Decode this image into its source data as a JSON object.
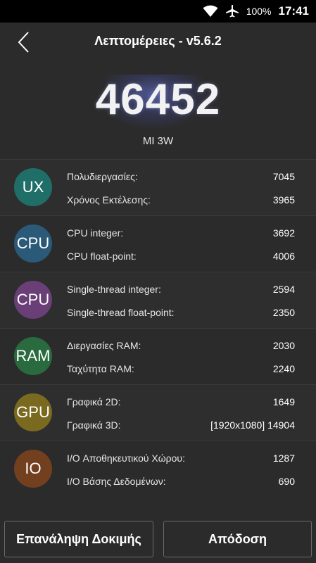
{
  "status_bar": {
    "battery": "100%",
    "time": "17:41",
    "icons": [
      "wifi-icon",
      "airplane-icon"
    ]
  },
  "header": {
    "title": "Λεπτομέρειες - v5.6.2",
    "back_icon": "chevron-left-icon"
  },
  "score": {
    "value": "46452",
    "device": "MI 3W"
  },
  "categories": [
    {
      "badge": "UX",
      "color": "#1f6f68",
      "metrics": [
        {
          "label": "Πολυδιεργασίες:",
          "value": "7045"
        },
        {
          "label": "Χρόνος Εκτέλεσης:",
          "value": "3965"
        }
      ]
    },
    {
      "badge": "CPU",
      "color": "#2a5a78",
      "metrics": [
        {
          "label": "CPU integer:",
          "value": "3692"
        },
        {
          "label": "CPU float-point:",
          "value": "4006"
        }
      ]
    },
    {
      "badge": "CPU",
      "color": "#6a3f77",
      "metrics": [
        {
          "label": "Single-thread integer:",
          "value": "2594"
        },
        {
          "label": "Single-thread float-point:",
          "value": "2350"
        }
      ]
    },
    {
      "badge": "RAM",
      "color": "#2a6a3f",
      "metrics": [
        {
          "label": "Διεργασίες RAM:",
          "value": "2030"
        },
        {
          "label": "Ταχύτητα RAM:",
          "value": "2240"
        }
      ]
    },
    {
      "badge": "GPU",
      "color": "#7a6a1f",
      "metrics": [
        {
          "label": "Γραφικά 2D:",
          "value": "1649"
        },
        {
          "label": "Γραφικά 3D:",
          "value": "[1920x1080] 14904"
        }
      ]
    },
    {
      "badge": "IO",
      "color": "#73401f",
      "metrics": [
        {
          "label": "I/O Αποθηκευτικού Χώρου:",
          "value": "1287"
        },
        {
          "label": "I/O Βάσης Δεδομένων:",
          "value": "690"
        }
      ]
    }
  ],
  "buttons": {
    "retest": "Επανάληψη Δοκιμής",
    "performance": "Απόδοση"
  }
}
